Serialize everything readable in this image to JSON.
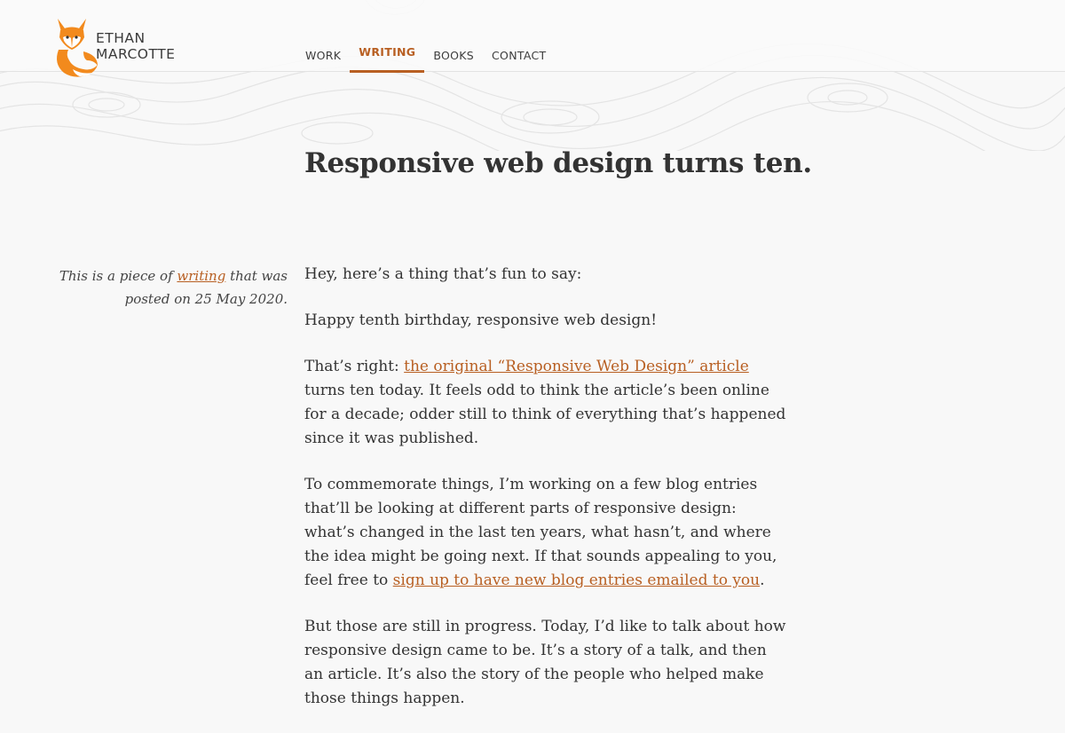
{
  "site": {
    "logo": {
      "line1": "ETHAN",
      "line2": "MARCOTTE"
    }
  },
  "nav": {
    "items": [
      {
        "label": "WORK",
        "active": false
      },
      {
        "label": "WRITING",
        "active": true
      },
      {
        "label": "BOOKS",
        "active": false
      },
      {
        "label": "CONTACT",
        "active": false
      }
    ]
  },
  "article": {
    "title": "Responsive web design turns ten.",
    "meta": {
      "prefix": "This is a piece of ",
      "link": "writing",
      "suffix": " that was posted on 25 May 2020."
    },
    "p1": "Hey, here’s a thing that’s fun to say:",
    "p2": "Happy tenth birthday, responsive web design!",
    "p3": {
      "before": "That’s right: ",
      "link": "the original “Responsive Web Design” article",
      "after": " turns ten today. It feels odd to think the article’s been online for a decade; odder still to think of everything that’s happened since it was published."
    },
    "p4": {
      "before": "To commemorate things, I’m working on a few blog entries that’ll be looking at different parts of responsive design: what’s changed in the last ten years, what hasn’t, and where the idea might be going next. If that sounds appealing to you, feel free to ",
      "link": "sign up to have new blog entries emailed to you",
      "after": "."
    },
    "p5": "But those are still in progress. Today, I’d like to talk about how responsive design came to be. It’s a story of a talk, and then an article. It’s also the story of the people who helped make those things happen."
  },
  "colors": {
    "accent": "#b85f22",
    "fox_orange": "#f28a1d",
    "text": "#333333",
    "background": "#f8f8f8"
  },
  "icons": {
    "logo": "fox-logo-icon"
  }
}
